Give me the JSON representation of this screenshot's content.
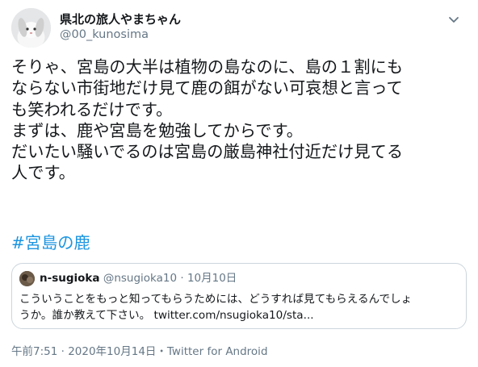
{
  "author": {
    "display_name": "県北の旅人やまちゃん",
    "handle": "@00_kunosima"
  },
  "tweet": {
    "lines": [
      "そりゃ、宮島の大半は植物の島なのに、島の１割にも",
      "ならない市街地だけ見て鹿の餌がない可哀想と言って",
      "も笑われるだけです。",
      "まずは、鹿や宮島を勉強してからです。",
      "だいたい騒いでるのは宮島の厳島神社付近だけ見てる",
      "人です。"
    ],
    "hashtag": "#宮島の鹿"
  },
  "quoted": {
    "display_name": "n-sugioka",
    "handle": "@nsugioka10",
    "separator": " · ",
    "date": "10月10日",
    "line1": "こういうことをもっと知ってもらうためには、どうすれば見てもらえるんでしょ",
    "line2_text": "うか。誰か教えて下さい。 ",
    "link": "twitter.com/nsugioka10/sta..."
  },
  "footer": {
    "time": "午前7:51",
    "sep1": " · ",
    "date": "2020年10月14日",
    "sep2": "・",
    "source": "Twitter for Android"
  },
  "colors": {
    "text": "#14171a",
    "secondary": "#657786",
    "link": "#1b95e0",
    "border": "#ccd6dd"
  },
  "icons": {
    "more": "chevron-down-icon"
  }
}
